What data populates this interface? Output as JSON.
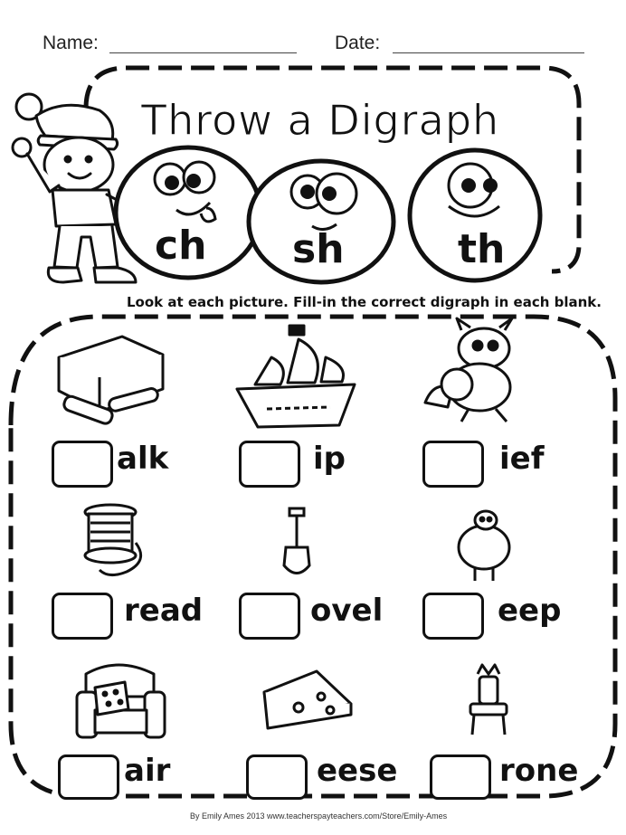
{
  "header": {
    "name_label": "Name:",
    "date_label": "Date:"
  },
  "title": "Throw a Digraph",
  "digraphs": [
    "ch",
    "sh",
    "th"
  ],
  "instructions": "Look at each picture.  Fill-in the correct digraph in each blank.",
  "items": [
    {
      "picture": "books-and-chalk",
      "word_end": "alk"
    },
    {
      "picture": "pirate-ship",
      "word_end": "ip"
    },
    {
      "picture": "raccoon-thief",
      "word_end": "ief"
    },
    {
      "picture": "spool-of-thread",
      "word_end": "read"
    },
    {
      "picture": "shovel",
      "word_end": "ovel"
    },
    {
      "picture": "sheep",
      "word_end": "eep"
    },
    {
      "picture": "armchair",
      "word_end": "air"
    },
    {
      "picture": "cheese",
      "word_end": "eese"
    },
    {
      "picture": "throne",
      "word_end": "rone"
    }
  ],
  "footer": {
    "credit": "By Emily Ames 2013 www.teacherspayteachers.com/Store/Emily-Ames"
  }
}
